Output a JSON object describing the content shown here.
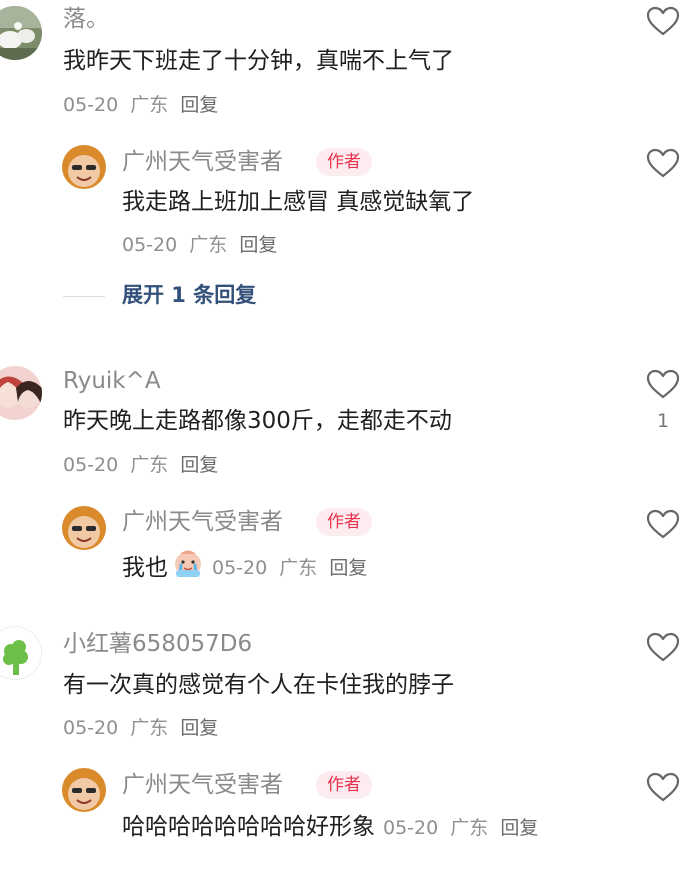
{
  "comments": [
    {
      "username": "落。",
      "content": "我昨天下班走了十分钟，真喘不上气了",
      "date": "05-20",
      "location": "广东",
      "reply_label": "回复",
      "reply": {
        "username": "广州天气受害者",
        "badge": "作者",
        "content": "我走路上班加上感冒 真感觉缺氧了",
        "date": "05-20",
        "location": "广东",
        "reply_label": "回复"
      },
      "expand_label": "展开 1 条回复"
    },
    {
      "username": "Ryuik^A",
      "content": "昨天晚上走路都像300斤，走都走不动",
      "date": "05-20",
      "location": "广东",
      "reply_label": "回复",
      "like_count": "1",
      "reply": {
        "username": "广州天气受害者",
        "badge": "作者",
        "content": "我也",
        "date": "05-20",
        "location": "广东",
        "reply_label": "回复"
      }
    },
    {
      "username": "小红薯658057D6",
      "content": "有一次真的感觉有个人在卡住我的脖子",
      "date": "05-20",
      "location": "广东",
      "reply_label": "回复",
      "reply": {
        "username": "广州天气受害者",
        "badge": "作者",
        "content": "哈哈哈哈哈哈哈哈好形象",
        "date": "05-20",
        "location": "广东",
        "reply_label": "回复"
      }
    }
  ],
  "icons": {
    "like": "heart-outline-icon",
    "emoji": "crying-emoji-icon"
  },
  "colors": {
    "author_badge_text": "#e5344d",
    "author_badge_bg": "#fdecef",
    "expand_link": "#33507a",
    "username": "#8a8a8a"
  }
}
